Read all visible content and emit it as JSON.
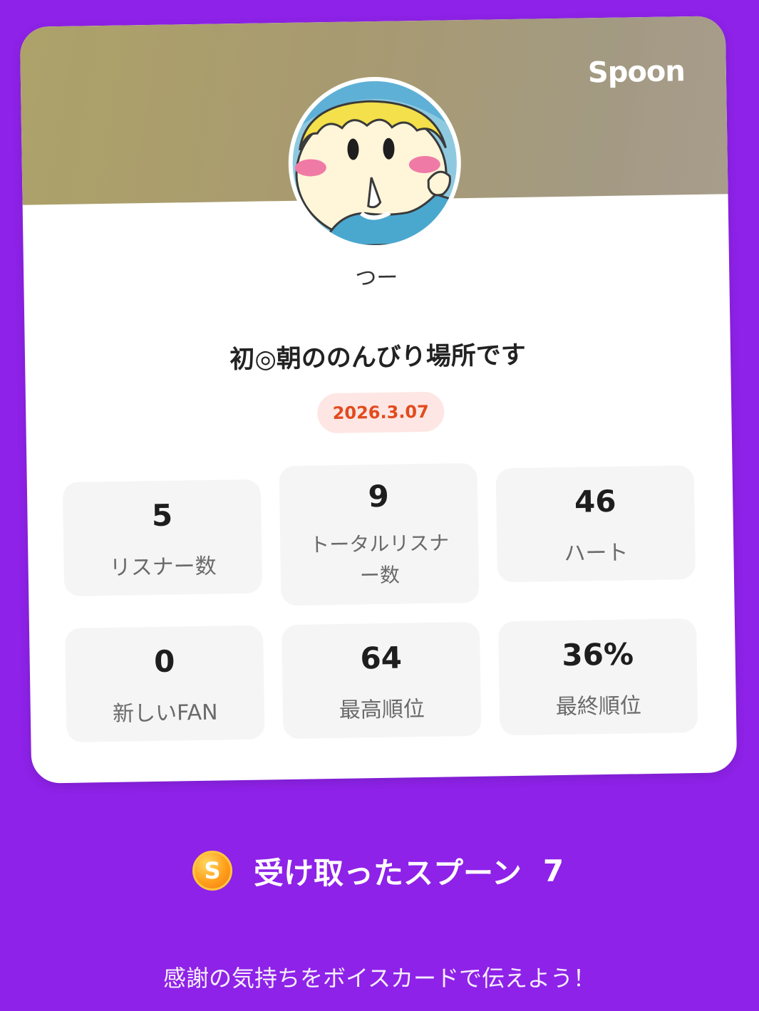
{
  "app": {
    "logo": "Spoon"
  },
  "profile": {
    "username": "つー"
  },
  "broadcast": {
    "title": "初◎朝ののんびり場所です",
    "date": "2026.3.07"
  },
  "stats": [
    {
      "value": "5",
      "label": "リスナー数"
    },
    {
      "value": "9",
      "label": "トータルリスナー数"
    },
    {
      "value": "46",
      "label": "ハート"
    },
    {
      "value": "0",
      "label": "新しいFAN"
    },
    {
      "value": "64",
      "label": "最高順位"
    },
    {
      "value": "36%",
      "label": "最終順位"
    }
  ],
  "spoons": {
    "icon": "spoon-coin-icon",
    "coin_letter": "S",
    "label": "受け取ったスプーン",
    "count": "7"
  },
  "footer": {
    "text": "感謝の気持ちをボイスカードで伝えよう！"
  },
  "colors": {
    "background": "#8e22e8",
    "date_text": "#e24a1d",
    "date_bg": "#fde6e3",
    "card": "#ffffff"
  }
}
